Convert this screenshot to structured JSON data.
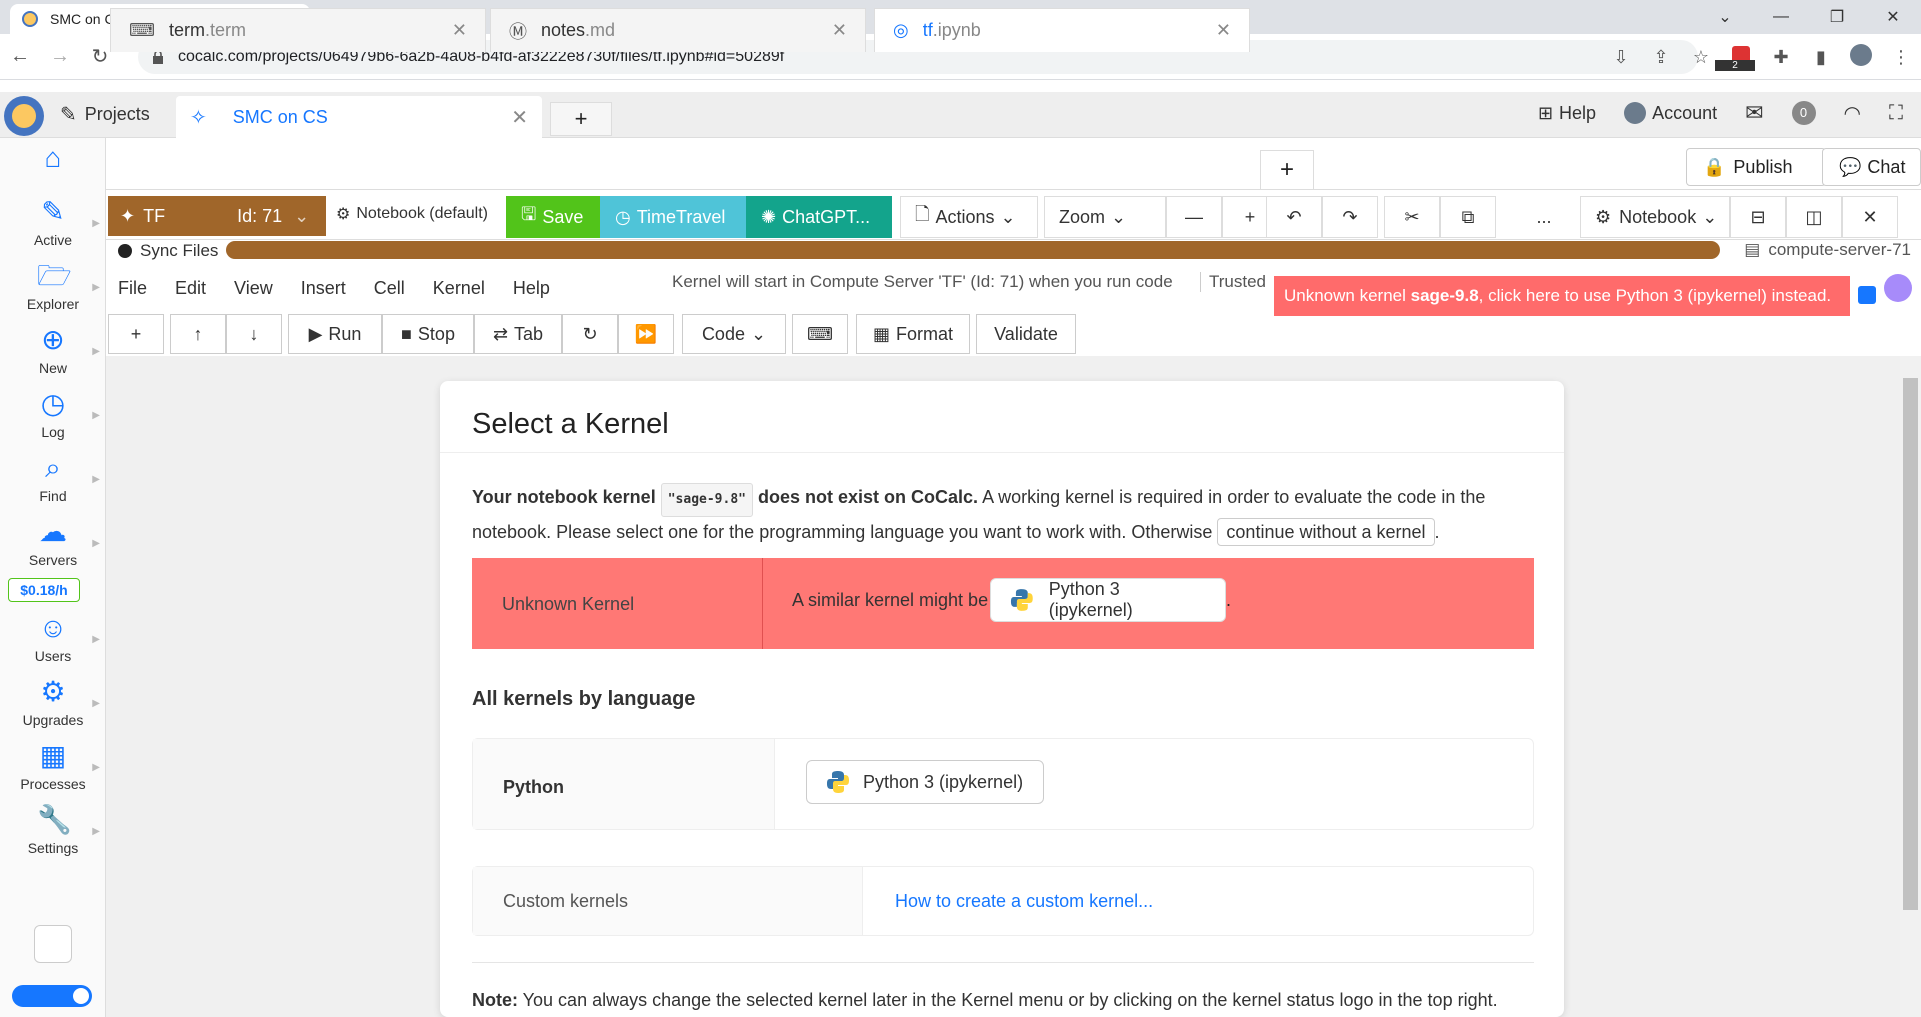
{
  "browser": {
    "tab_title": "SMC on CS - CoCalc",
    "url": "cocalc.com/projects/064979b6-6a2b-4a08-b4fd-af3222e8730f/files/tf.ipynb#id=50289f",
    "extension_badge": "2"
  },
  "topbar": {
    "projects_label": "Projects",
    "project_tab": "SMC on CS",
    "help_label": "Help",
    "account_label": "Account",
    "notification_count": "0"
  },
  "sidebar": {
    "items": [
      {
        "label": "Active",
        "icon": "pencil-icon"
      },
      {
        "label": "Explorer",
        "icon": "folder-icon"
      },
      {
        "label": "New",
        "icon": "plus-circle-icon"
      },
      {
        "label": "Log",
        "icon": "history-icon"
      },
      {
        "label": "Find",
        "icon": "search-icon"
      },
      {
        "label": "Servers",
        "icon": "server-icon"
      },
      {
        "label": "Users",
        "icon": "users-icon"
      },
      {
        "label": "Upgrades",
        "icon": "sliders-icon"
      },
      {
        "label": "Processes",
        "icon": "processes-icon"
      },
      {
        "label": "Settings",
        "icon": "wrench-icon"
      }
    ],
    "cost": "$0.18/h"
  },
  "file_tabs": [
    {
      "name": "term",
      "ext": ".term"
    },
    {
      "name": "notes",
      "ext": ".md"
    },
    {
      "name": "tf",
      "ext": ".ipynb"
    }
  ],
  "file_actions": {
    "publish": "Publish",
    "chat": "Chat"
  },
  "frame": {
    "server_name": "TF",
    "server_id": "Id: 71",
    "kernel_label": "Notebook (default)",
    "save": "Save",
    "timetravel": "TimeTravel",
    "chatgpt": "ChatGPT...",
    "actions": "Actions",
    "zoom": "Zoom",
    "more": "...",
    "notebook": "Notebook"
  },
  "sync": {
    "label": "Sync Files",
    "compute_server": "compute-server-71"
  },
  "menu": [
    "File",
    "Edit",
    "View",
    "Insert",
    "Cell",
    "Kernel",
    "Help"
  ],
  "kernel_status": "Kernel will start in Compute Server 'TF' (Id: 71) when you run code",
  "trusted": "Trusted",
  "unknown_warning": {
    "pre": "Unknown kernel ",
    "name": "sage-9.8",
    "post": ", click here to use Python 3 (ipykernel) instead."
  },
  "cell_toolbar": {
    "run": "Run",
    "stop": "Stop",
    "tab": "Tab",
    "cell_type": "Code",
    "format": "Format",
    "validate": "Validate"
  },
  "dialog": {
    "title": "Select a Kernel",
    "intro_a": "Your notebook kernel",
    "kernel_code": "\"sage-9.8\"",
    "intro_b": "does not exist on CoCalc.",
    "intro_c": " A working kernel is required in order to evaluate the code in the notebook. Please select one for the programming language you want to work with. Otherwise ",
    "continue_btn": "continue without a kernel",
    "intro_end": ".",
    "unknown_label": "Unknown Kernel",
    "similar_text": "A similar kernel might be",
    "similar_kernel": "Python 3 (ipykernel)",
    "dot": ".",
    "all_kernels": "All kernels by language",
    "language": "Python",
    "python_kernel": "Python 3 (ipykernel)",
    "custom_label": "Custom kernels",
    "custom_link": "How to create a custom kernel...",
    "note_bold": "Note:",
    "note_text": " You can always change the selected kernel later in the Kernel menu or by clicking on the kernel status logo in the top right."
  },
  "colors": {
    "accent": "#1677ff",
    "server_brown": "#a0662a",
    "warning_red": "#ff7875",
    "save_green": "#52c41a"
  }
}
